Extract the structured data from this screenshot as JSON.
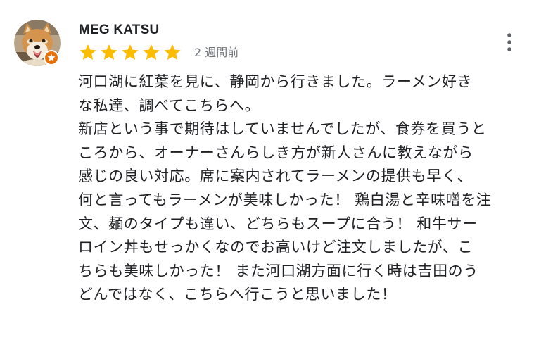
{
  "review": {
    "reviewer_name": "MEG KATSU",
    "rating": 5,
    "rating_max": 5,
    "date": "2 週間前",
    "lines": [
      "河口湖に紅葉を見に、静岡から行きました。ラーメン好き",
      "な私達、調べてこちらへ。",
      "新店という事で期待はしていませんでしたが、食券を買うと",
      "ころから、オーナーさんらしき方が新人さんに教えながら",
      "感じの良い対応。席に案内されてラーメンの提供も早く、",
      "何と言ってもラーメンが美味しかった！ 鶏白湯と辛味噌を注",
      "文、麺のタイプも違い、どちらもスープに合う！ 和牛サー",
      "ロイン丼もせっかくなのでお高いけど注文しましたが、こ",
      "ちらも美味しかった！ また河口湖方面に行く時は吉田のう",
      "どんではなく、こちらへ行こうと思いました！"
    ]
  },
  "icons": {
    "avatar": "shiba-dog-photo",
    "badge": "local-guide-star-badge-icon",
    "star": "star-filled-icon",
    "menu": "more-vertical-icon"
  },
  "colors": {
    "star": "#fbbc04",
    "badge": "#e8710a",
    "name": "#202124",
    "date": "#70757a",
    "body_text": "#202124",
    "menu_icon": "#5f6368"
  }
}
